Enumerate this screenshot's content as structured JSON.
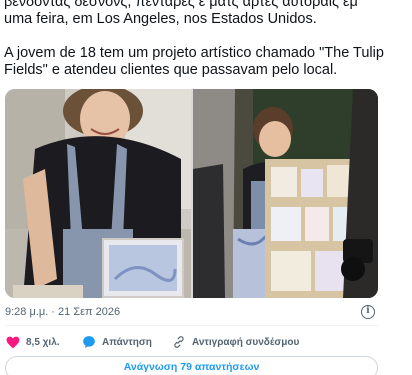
{
  "tweet": {
    "text_line1": "βενδοντας δεσνονς, πενταρες ε ματς αρτες αυτοραις εμ",
    "text_line2": "uma feira, em Los Angeles, nos Estados Unidos.",
    "text_para2": "A jovem de 18 tem um projeto artístico chamado \"The Tulip Fields\" e atendeu clientes que passavam pelo local."
  },
  "meta": {
    "timestamp": "9:28 μ.μ. · 21 Σεπ 2026",
    "info_icon": "info-icon"
  },
  "actions": {
    "likes": "8,5 χιλ.",
    "reply_label": "Απάντηση",
    "copy_link_label": "Αντιγραφή συνδέσμου"
  },
  "replies_button": "Ανάγνωση 79 απαντήσεων",
  "colors": {
    "like": "#f91880",
    "reply": "#1d9bf0",
    "link_text": "#1d9bf0",
    "secondary_text": "#536471"
  }
}
